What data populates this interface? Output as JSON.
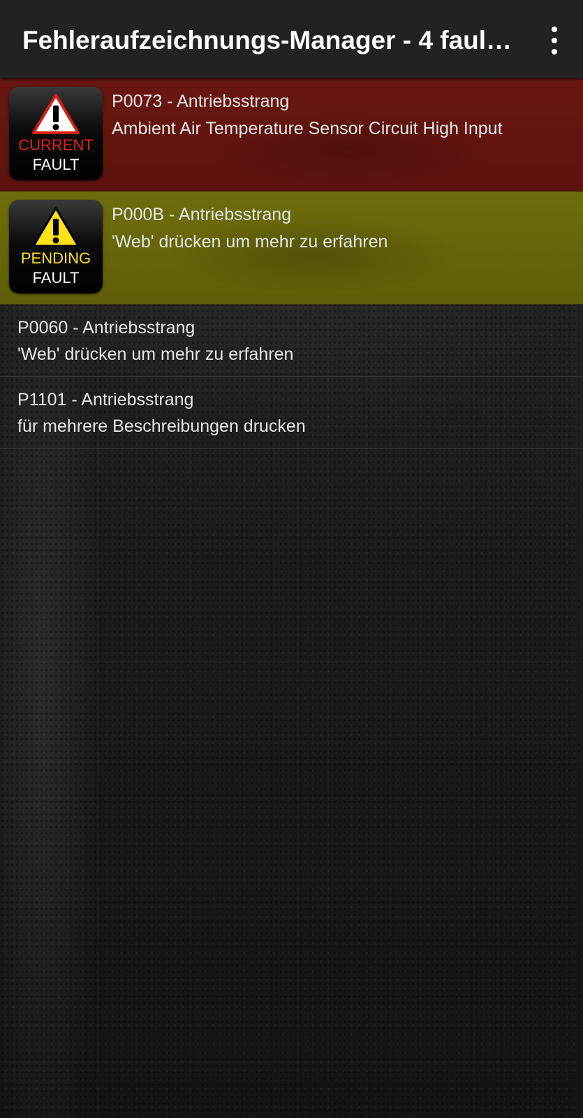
{
  "app_bar": {
    "title": "Fehleraufzeichnungs-Manager - 4 faul…",
    "menu_icon": "overflow-menu-icon"
  },
  "colors": {
    "current_fault_bg": "#6a1712",
    "pending_fault_bg": "#6e6d0c",
    "app_bar_bg": "#222222",
    "badge_current_text": "#e2231a",
    "badge_pending_text": "#ffe21a"
  },
  "faults": [
    {
      "code": "P0073 - Antriebsstrang",
      "description": "Ambient Air Temperature Sensor Circuit High Input",
      "status": "current",
      "badge": {
        "line1": "CURRENT",
        "line2": "FAULT",
        "icon": "warning-triangle-icon"
      }
    },
    {
      "code": "P000B - Antriebsstrang",
      "description": "'Web' drücken um mehr zu erfahren",
      "status": "pending",
      "badge": {
        "line1": "PENDING",
        "line2": "FAULT",
        "icon": "warning-triangle-icon"
      }
    },
    {
      "code": "P0060 - Antriebsstrang",
      "description": "'Web' drücken um mehr zu erfahren",
      "status": "stored"
    },
    {
      "code": "P1101 - Antriebsstrang",
      "description": "für mehrere Beschreibungen drucken",
      "status": "stored"
    }
  ]
}
